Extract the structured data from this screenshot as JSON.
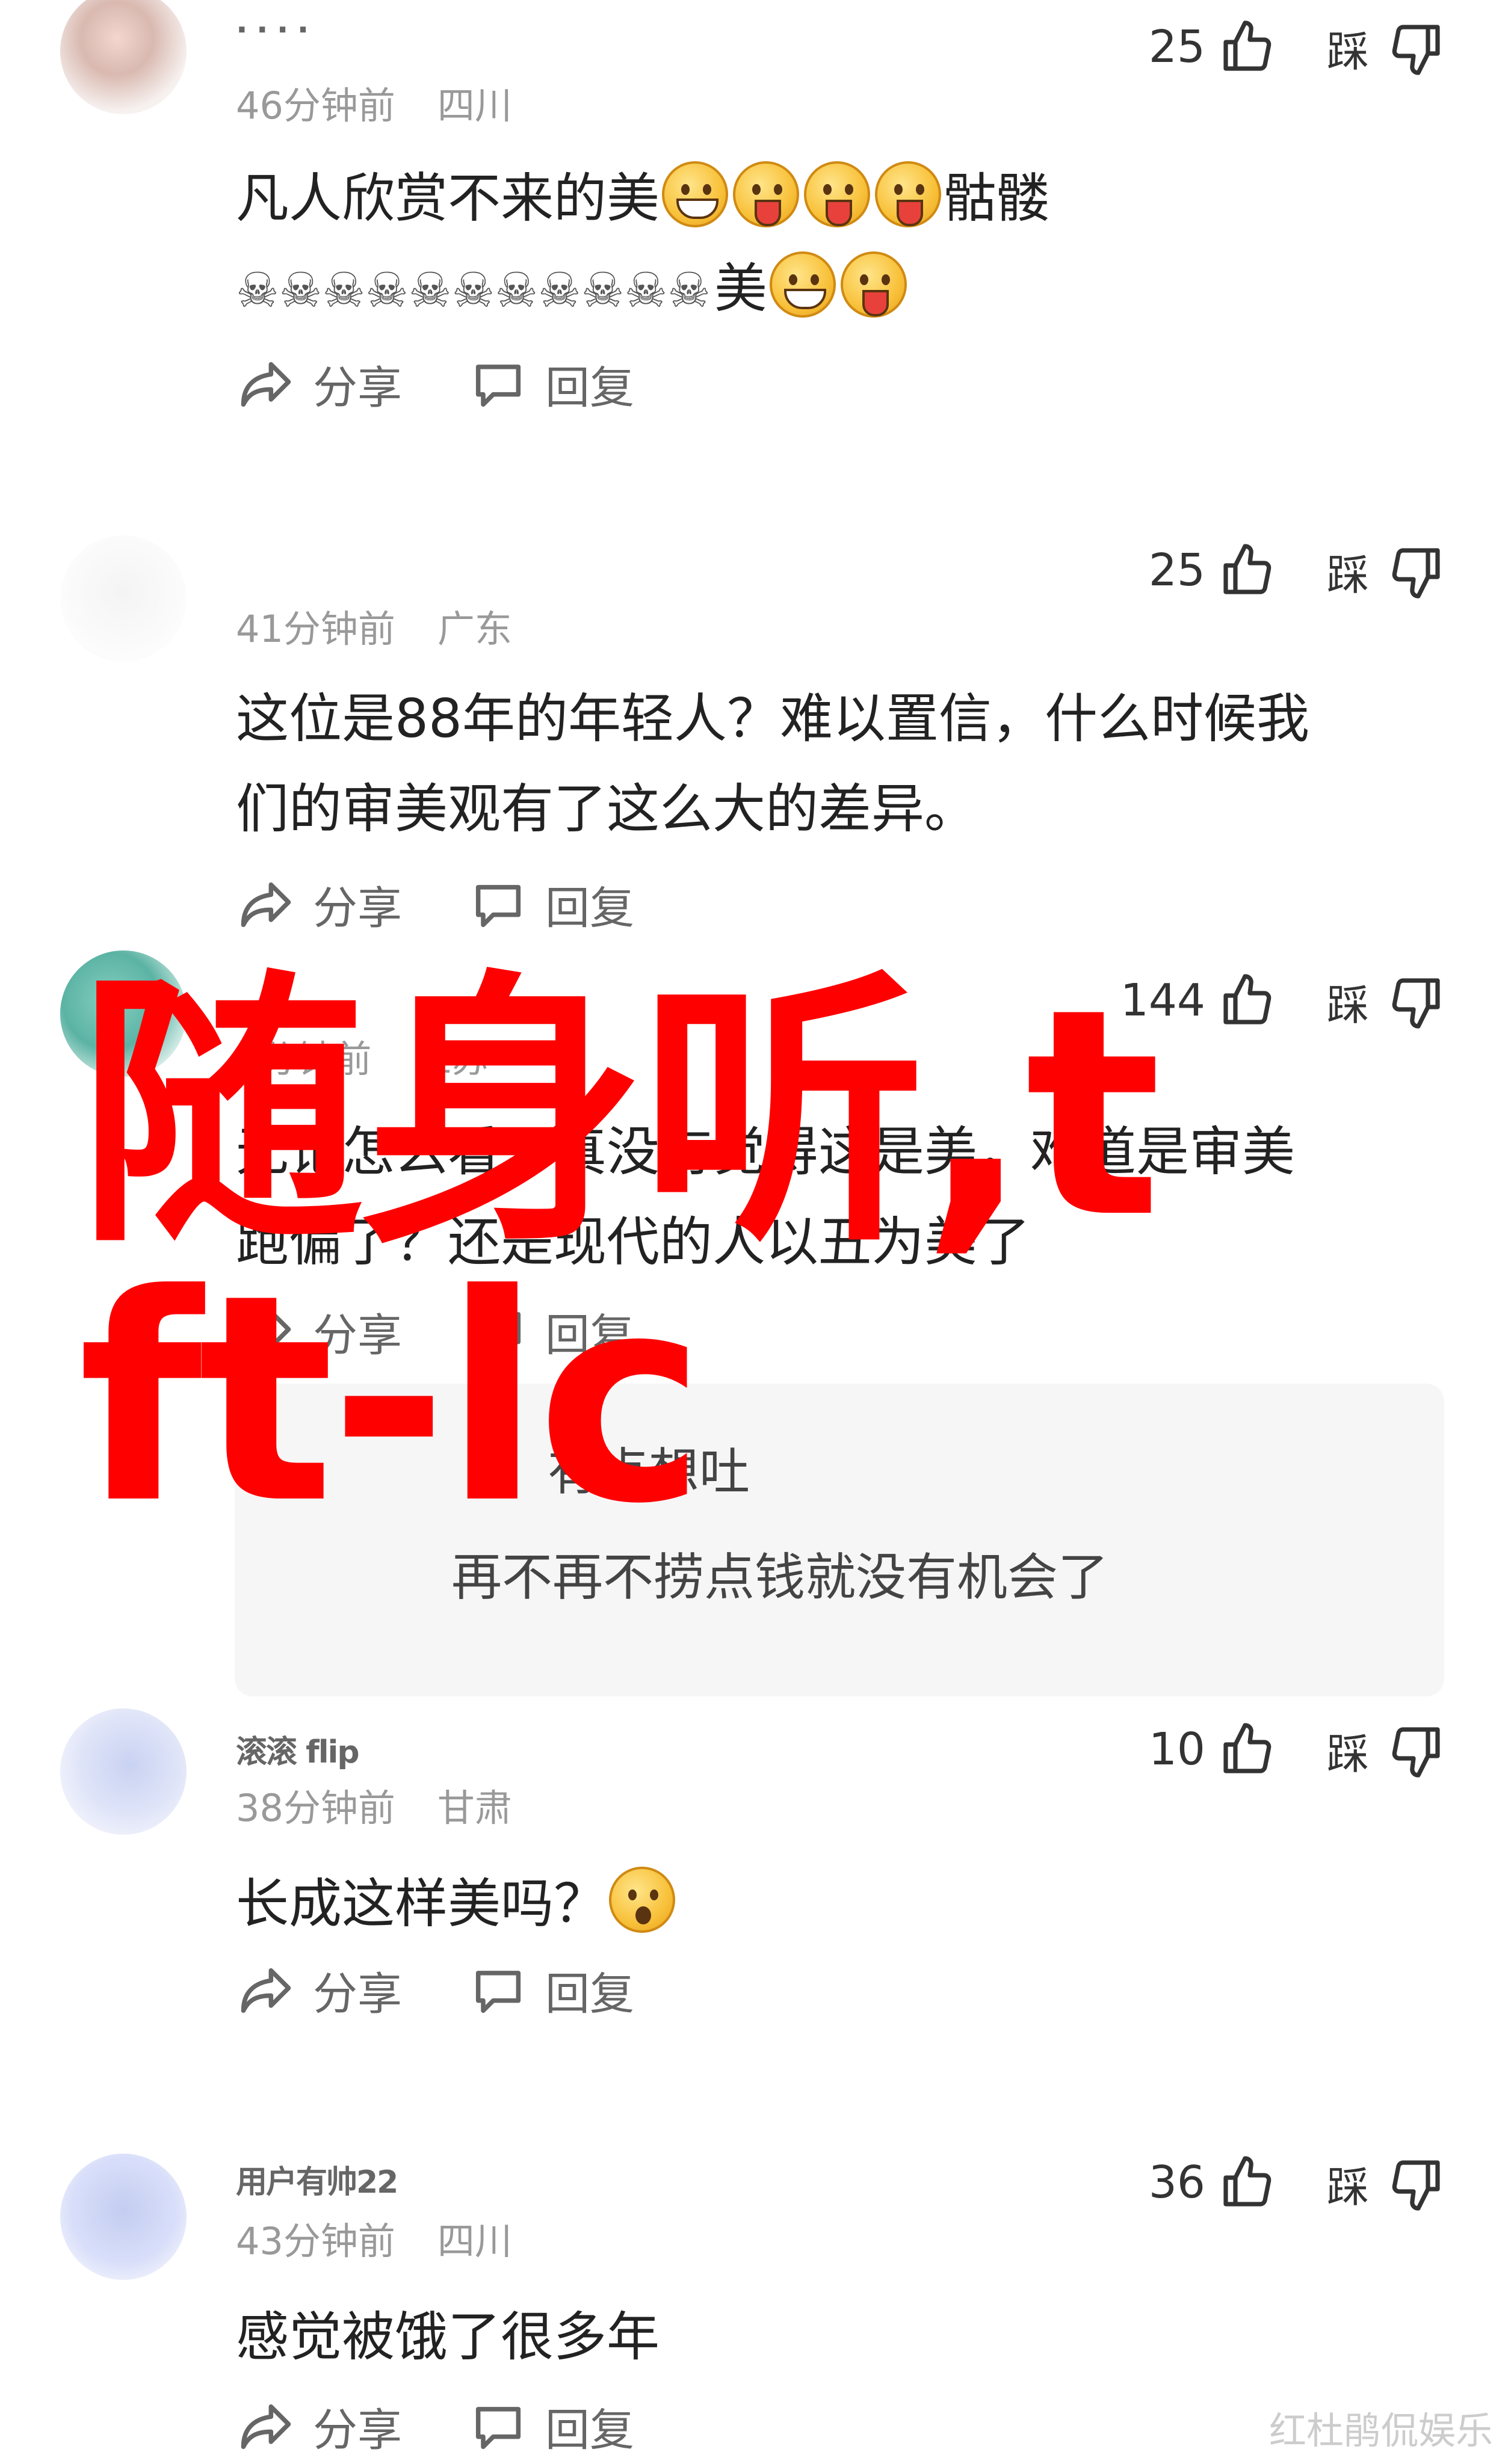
{
  "comments": [
    {
      "username": "· ·  · ·",
      "time": "46分钟前",
      "region": "四川",
      "likes": "25",
      "dislike_label": "踩",
      "text_line1_a": "凡人欣赏不来的美",
      "text_line1_b": "骷髅",
      "text_line2_b": "美",
      "emojis_line1": [
        "grinning-face",
        "squinting-tongue-face",
        "squinting-tongue-face",
        "squinting-tongue-face"
      ],
      "skull_count": 11,
      "emojis_line2": [
        "grinning-face",
        "squinting-tongue-face"
      ]
    },
    {
      "username": "",
      "time": "41分钟前",
      "region": "广东",
      "likes": "25",
      "dislike_label": "踩",
      "text_line1": "这位是88年的年轻人？难以置信，什么时候我",
      "text_line2": "们的审美观有了这么大的差异。"
    },
    {
      "username": "",
      "time": "3分钟前",
      "region": "江苏",
      "likes": "144",
      "dislike_label": "踩",
      "text_line1": "无论怎么看，真没有觉得这是美，难道是审美",
      "text_line2": "跑偏了？还是现代的人以丑为美了",
      "replies": [
        "有点想吐",
        "再不再不捞点钱就没有机会了"
      ]
    },
    {
      "username": "滚滚 flip",
      "time": "38分钟前",
      "region": "甘肃",
      "likes": "10",
      "dislike_label": "踩",
      "text_line1": "长成这样美吗？",
      "emojis_line1": [
        "astonished-question-face"
      ]
    },
    {
      "username": "用户有帅22",
      "time": "43分钟前",
      "region": "四川",
      "likes": "36",
      "dislike_label": "踩",
      "text_line1": "感觉被饿了很多年"
    }
  ],
  "actions": {
    "share_label": "分享",
    "reply_label": "回复"
  },
  "overlay": {
    "line1": "随身听,t",
    "line2": "ft-lc",
    "color": "#ff0000"
  },
  "credit": "红杜鹃侃娱乐"
}
